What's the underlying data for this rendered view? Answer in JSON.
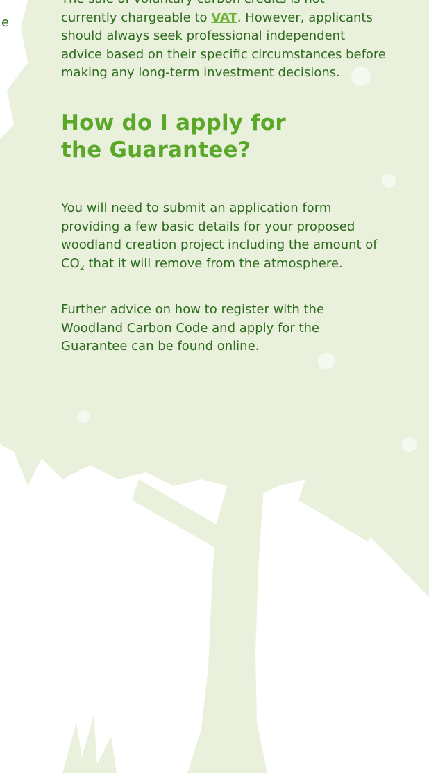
{
  "margin_fragment": "e",
  "para1": {
    "line0": "The sale of voluntary carbon credits is not",
    "line1_prefix": "currently chargeable to ",
    "vat_link": "VAT",
    "line1_suffix": ". However,",
    "rest": "applicants should always seek professional independent advice based on their specific circumstances before making any long-term investment decisions."
  },
  "heading": {
    "line1": "How do I apply for",
    "line2": "the Guarantee?"
  },
  "para2": {
    "before": "You will need to submit an application form providing a few basic details for your proposed woodland creation project including the amount of CO",
    "subscript": "2",
    "after": " that it will remove from the atmosphere."
  },
  "para3": "Further advice on how to register with the Woodland Carbon Code and apply for the Guarantee can be found online.",
  "colors": {
    "body_text": "#2f6b1f",
    "heading": "#5aa729",
    "link": "#6fb23a",
    "tree_silhouette": "#e9f1dc"
  }
}
